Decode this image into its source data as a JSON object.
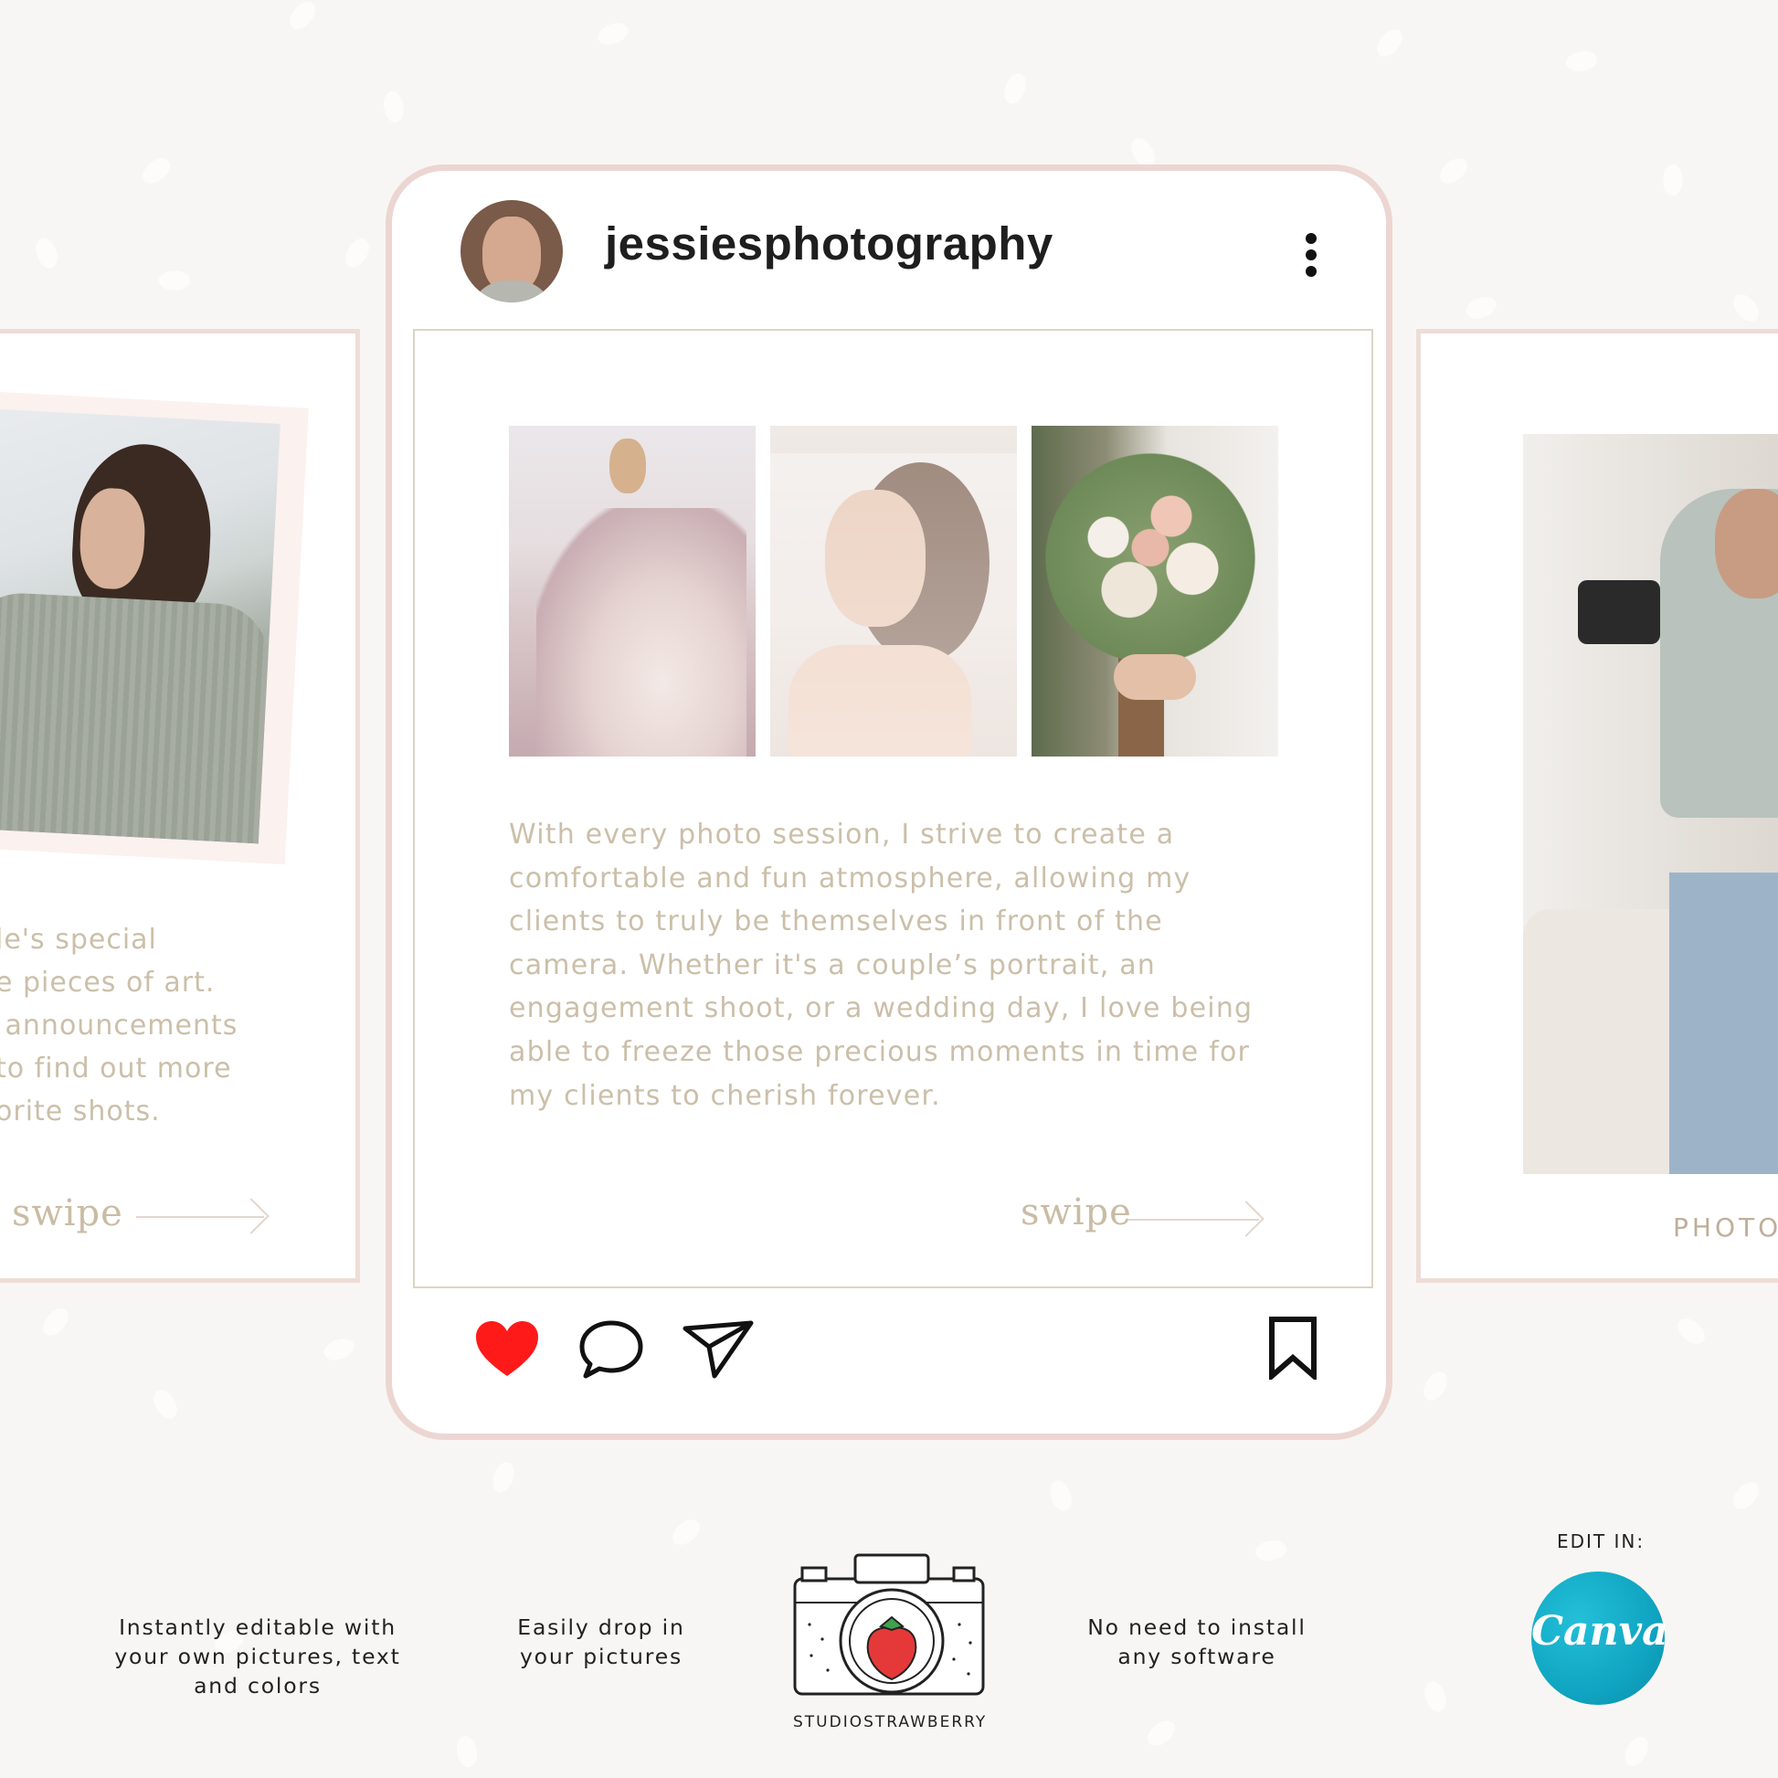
{
  "post": {
    "username": "jessiesphotography",
    "caption": "With every photo session, I strive to create a comfortable and fun atmosphere, allowing my clients to truly be themselves in front of the camera. Whether it's a couple’s portrait, an engagement shoot, or a wedding day, I love being able to freeze those precious moments in time for my clients to cherish forever.",
    "swipe_label": "swipe",
    "liked": true
  },
  "left_card": {
    "text_lines": [
      "le's special",
      "e pieces of art.",
      " announcements",
      "to find out more",
      "orite shots."
    ],
    "swipe_label": "swipe"
  },
  "right_card": {
    "label": "PHOTO"
  },
  "features": {
    "editable": "Instantly editable with your own pictures, text and colors",
    "drop": "Easily drop in your pictures",
    "no_install": "No need to install any software"
  },
  "brand": {
    "name": "STUDIOSTRAWBERRY"
  },
  "edit_in": {
    "label": "EDIT IN:",
    "logo_text": "Canva"
  },
  "colors": {
    "heart": "#ff1a1a",
    "caption": "#cbbfa9",
    "frame": "#ecd6d1",
    "canva": "#10a5c2"
  },
  "icons": [
    "more-vertical-icon",
    "heart-icon",
    "comment-icon",
    "send-icon",
    "bookmark-icon",
    "arrow-right-icon",
    "camera-strawberry-logo",
    "canva-logo"
  ]
}
